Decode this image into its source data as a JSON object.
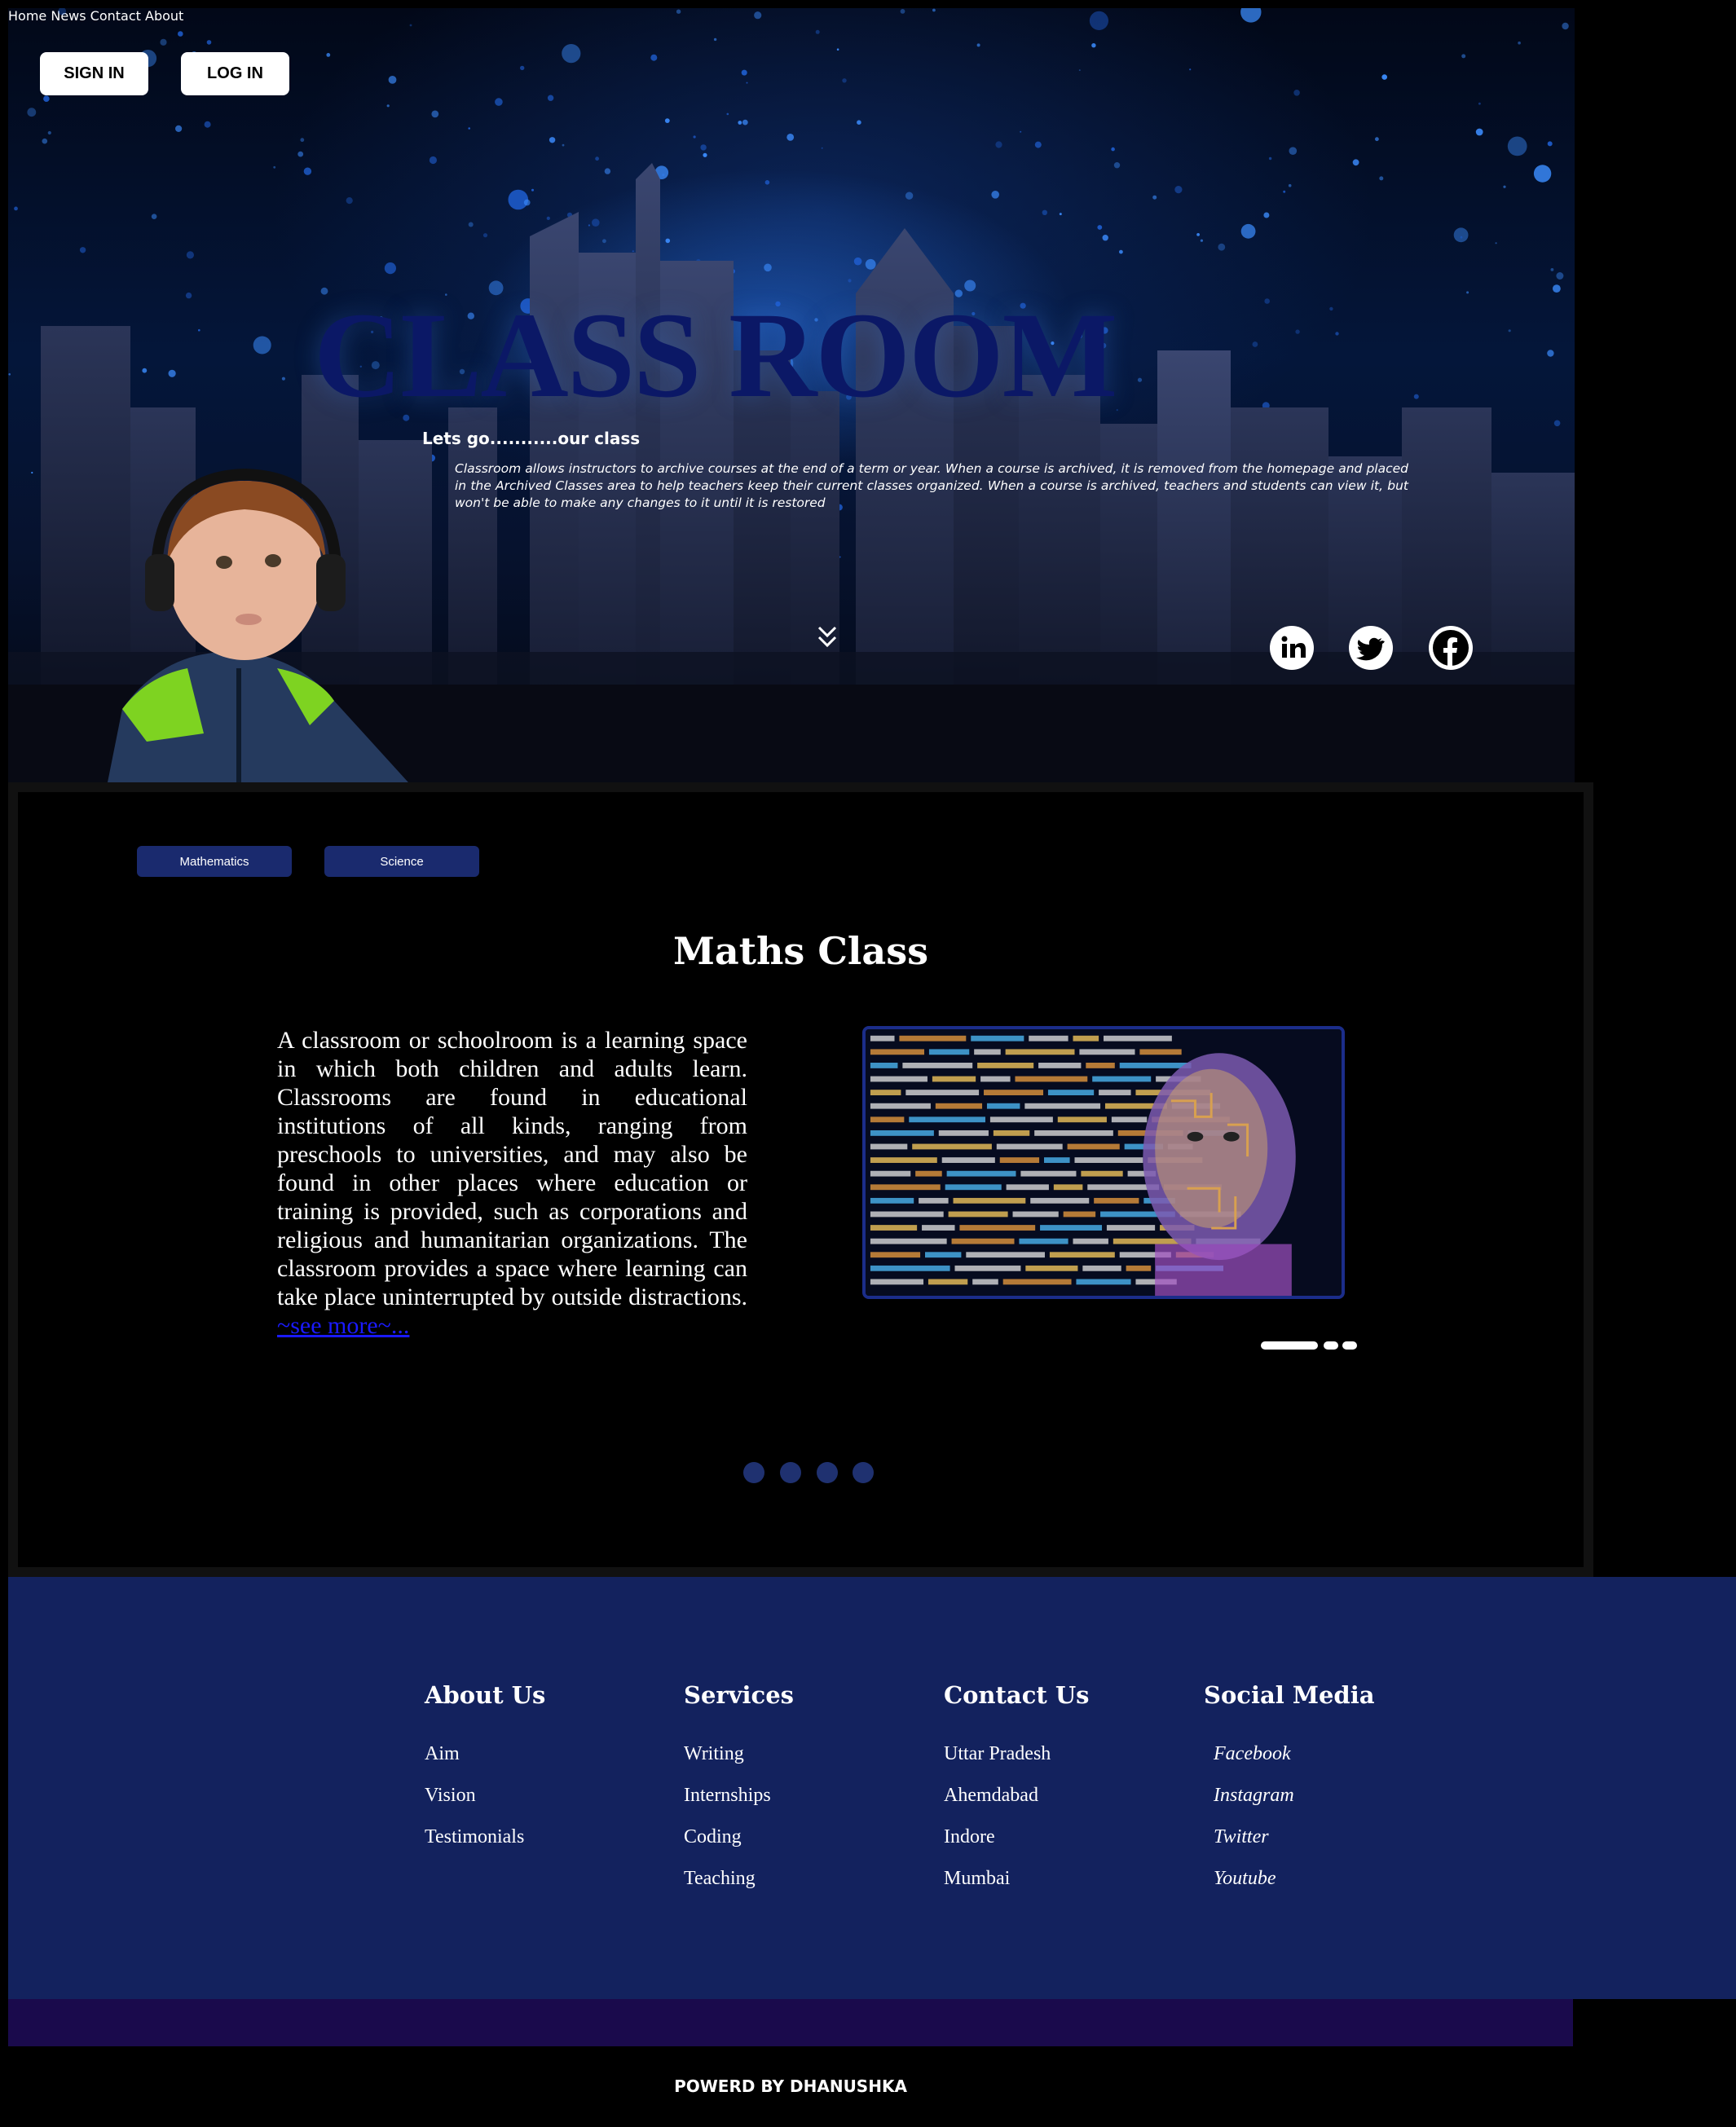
{
  "auth": {
    "sign_in": "SIGN IN",
    "log_in": "LOG IN"
  },
  "nav": {
    "items": [
      "Home",
      "News",
      "Contact",
      "About"
    ]
  },
  "hero": {
    "title": "CLASS ROOM",
    "subtitle": "Lets go...........our class",
    "description": "Classroom allows instructors to archive courses at the end of a term or year. When a course is archived, it is removed from the homepage and placed in the Archived Classes area to help teachers keep their current classes organized. When a course is archived, teachers and students can view it, but won't be able to make any changes to it until it is restored",
    "social_icons": [
      "linkedin-icon",
      "twitter-icon",
      "facebook-icon"
    ]
  },
  "classes": {
    "tabs": [
      "Mathematics",
      "Science"
    ],
    "title": "Maths Class",
    "body": "A classroom or schoolroom is a learning space in which both children and adults learn. Classrooms are found in educational institutions of all kinds, ranging from preschools to universities, and may also be found in other places where education or training is provided, such as corporations and religious and humanitarian organizations. The classroom provides a space where learning can take place uninterrupted by outside distractions.",
    "see_more": "~see more~..."
  },
  "footer": {
    "columns": [
      {
        "heading": "About Us",
        "items": [
          "Aim",
          "Vision",
          "Testimonials"
        ]
      },
      {
        "heading": "Services",
        "items": [
          "Writing",
          "Internships",
          "Coding",
          "Teaching"
        ]
      },
      {
        "heading": "Contact Us",
        "items": [
          "Uttar Pradesh",
          "Ahemdabad",
          "Indore",
          "Mumbai"
        ]
      },
      {
        "heading": "Social Media",
        "items": [
          "Facebook",
          "Instagram",
          "Twitter",
          "Youtube"
        ]
      }
    ],
    "powered": "POWERD BY DHANUSHKA"
  },
  "colors": {
    "title_navy": "#0b1866",
    "tab_blue": "#1a2a6e",
    "footer_blue": "#13225e",
    "strip_purple": "#1a0a4c",
    "dot_blue": "#1f3170",
    "link_blue": "#1a1aff"
  }
}
